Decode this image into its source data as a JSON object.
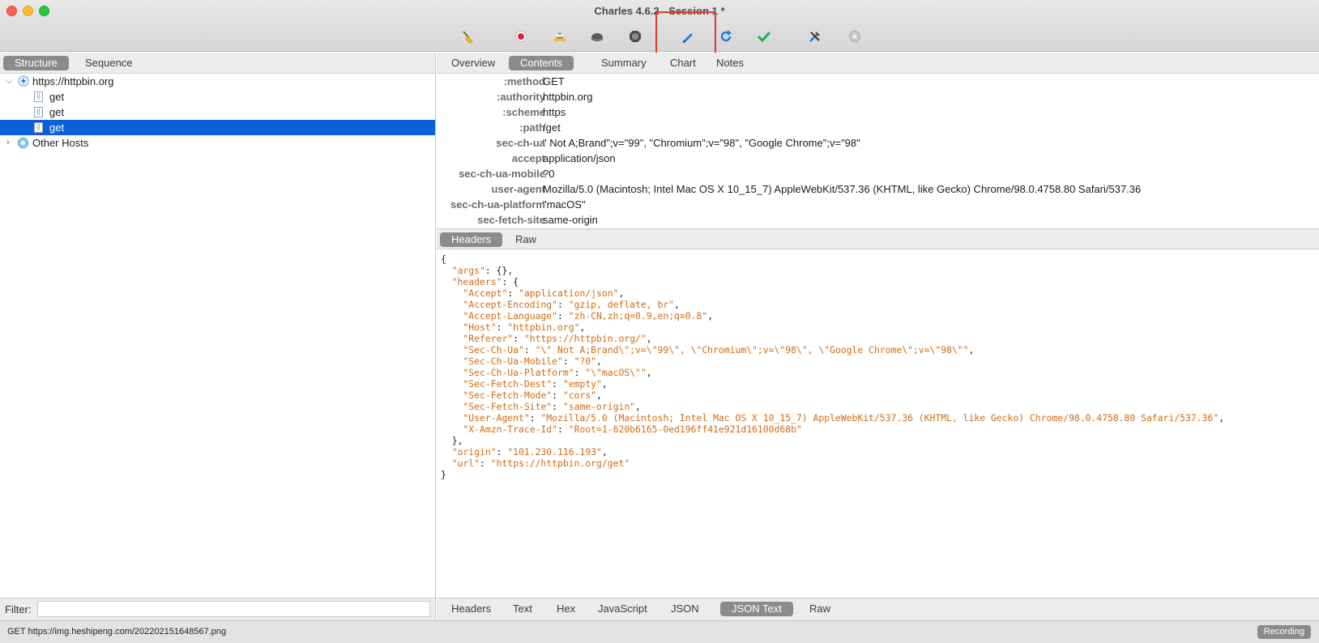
{
  "window": {
    "title": "Charles 4.6.2 - Session 1 *"
  },
  "toolbar": {
    "icons": [
      "broom-icon",
      "record-icon",
      "throttle-icon",
      "turtle-icon",
      "stop-icon",
      "compose-icon",
      "repeat-icon",
      "validate-icon",
      "tools-icon",
      "settings-icon"
    ]
  },
  "left": {
    "view_tabs": [
      "Structure",
      "Sequence"
    ],
    "active_view": "Structure",
    "tree": {
      "host": "https://httpbin.org",
      "children": [
        "get",
        "get",
        "get"
      ],
      "selected_index": 2,
      "other": "Other Hosts"
    },
    "filter_label": "Filter:",
    "filter_value": ""
  },
  "right": {
    "tabs": [
      "Overview",
      "Contents",
      "Summary",
      "Chart",
      "Notes"
    ],
    "active_tab": "Contents",
    "request_headers": [
      {
        "key": ":method",
        "value": "GET"
      },
      {
        "key": ":authority",
        "value": "httpbin.org"
      },
      {
        "key": ":scheme",
        "value": "https"
      },
      {
        "key": ":path",
        "value": "/get"
      },
      {
        "key": "sec-ch-ua",
        "value": "\" Not A;Brand\";v=\"99\", \"Chromium\";v=\"98\", \"Google Chrome\";v=\"98\""
      },
      {
        "key": "accept",
        "value": "application/json"
      },
      {
        "key": "sec-ch-ua-mobile",
        "value": "?0"
      },
      {
        "key": "user-agent",
        "value": "Mozilla/5.0 (Macintosh; Intel Mac OS X 10_15_7) AppleWebKit/537.36 (KHTML, like Gecko) Chrome/98.0.4758.80 Safari/537.36"
      },
      {
        "key": "sec-ch-ua-platform",
        "value": "\"macOS\""
      },
      {
        "key": "sec-fetch-site",
        "value": "same-origin"
      }
    ],
    "request_subtabs": [
      "Headers",
      "Raw"
    ],
    "active_request_subtab": "Headers",
    "response_lines": [
      [
        "{"
      ],
      [
        "  ",
        {
          "k": "\"args\""
        },
        ": {},"
      ],
      [
        "  ",
        {
          "k": "\"headers\""
        },
        ": {"
      ],
      [
        "    ",
        {
          "k": "\"Accept\""
        },
        ": ",
        {
          "s": "\"application/json\""
        },
        ","
      ],
      [
        "    ",
        {
          "k": "\"Accept-Encoding\""
        },
        ": ",
        {
          "s": "\"gzip, deflate, br\""
        },
        ","
      ],
      [
        "    ",
        {
          "k": "\"Accept-Language\""
        },
        ": ",
        {
          "s": "\"zh-CN,zh;q=0.9,en;q=0.8\""
        },
        ","
      ],
      [
        "    ",
        {
          "k": "\"Host\""
        },
        ": ",
        {
          "s": "\"httpbin.org\""
        },
        ","
      ],
      [
        "    ",
        {
          "k": "\"Referer\""
        },
        ": ",
        {
          "s": "\"https://httpbin.org/\""
        },
        ","
      ],
      [
        "    ",
        {
          "k": "\"Sec-Ch-Ua\""
        },
        ": ",
        {
          "s": "\"\\\" Not A;Brand\\\";v=\\\"99\\\", \\\"Chromium\\\";v=\\\"98\\\", \\\"Google Chrome\\\";v=\\\"98\\\"\""
        },
        ","
      ],
      [
        "    ",
        {
          "k": "\"Sec-Ch-Ua-Mobile\""
        },
        ": ",
        {
          "s": "\"?0\""
        },
        ","
      ],
      [
        "    ",
        {
          "k": "\"Sec-Ch-Ua-Platform\""
        },
        ": ",
        {
          "s": "\"\\\"macOS\\\"\""
        },
        ","
      ],
      [
        "    ",
        {
          "k": "\"Sec-Fetch-Dest\""
        },
        ": ",
        {
          "s": "\"empty\""
        },
        ","
      ],
      [
        "    ",
        {
          "k": "\"Sec-Fetch-Mode\""
        },
        ": ",
        {
          "s": "\"cors\""
        },
        ","
      ],
      [
        "    ",
        {
          "k": "\"Sec-Fetch-Site\""
        },
        ": ",
        {
          "s": "\"same-origin\""
        },
        ","
      ],
      [
        "    ",
        {
          "k": "\"User-Agent\""
        },
        ": ",
        {
          "s": "\"Mozilla/5.0 (Macintosh; Intel Mac OS X 10_15_7) AppleWebKit/537.36 (KHTML, like Gecko) Chrome/98.0.4758.80 Safari/537.36\""
        },
        ","
      ],
      [
        "    ",
        {
          "k": "\"X-Amzn-Trace-Id\""
        },
        ": ",
        {
          "s": "\"Root=1-620b6165-0ed196ff41e921d16100d68b\""
        }
      ],
      [
        "  },"
      ],
      [
        "  ",
        {
          "k": "\"origin\""
        },
        ": ",
        {
          "s": "\"101.230.116.193\""
        },
        ","
      ],
      [
        "  ",
        {
          "k": "\"url\""
        },
        ": ",
        {
          "s": "\"https://httpbin.org/get\""
        }
      ],
      [
        "}"
      ]
    ],
    "response_subtabs": [
      "Headers",
      "Text",
      "Hex",
      "JavaScript",
      "JSON",
      "JSON Text",
      "Raw"
    ],
    "active_response_subtab": "JSON Text"
  },
  "status": {
    "text": "GET https://img.heshipeng.com/202202151648567.png",
    "recording_label": "Recording"
  },
  "colors": {
    "selection": "#0a60d8",
    "json_key": "#d26b12",
    "highlight": "#e23a2a"
  }
}
